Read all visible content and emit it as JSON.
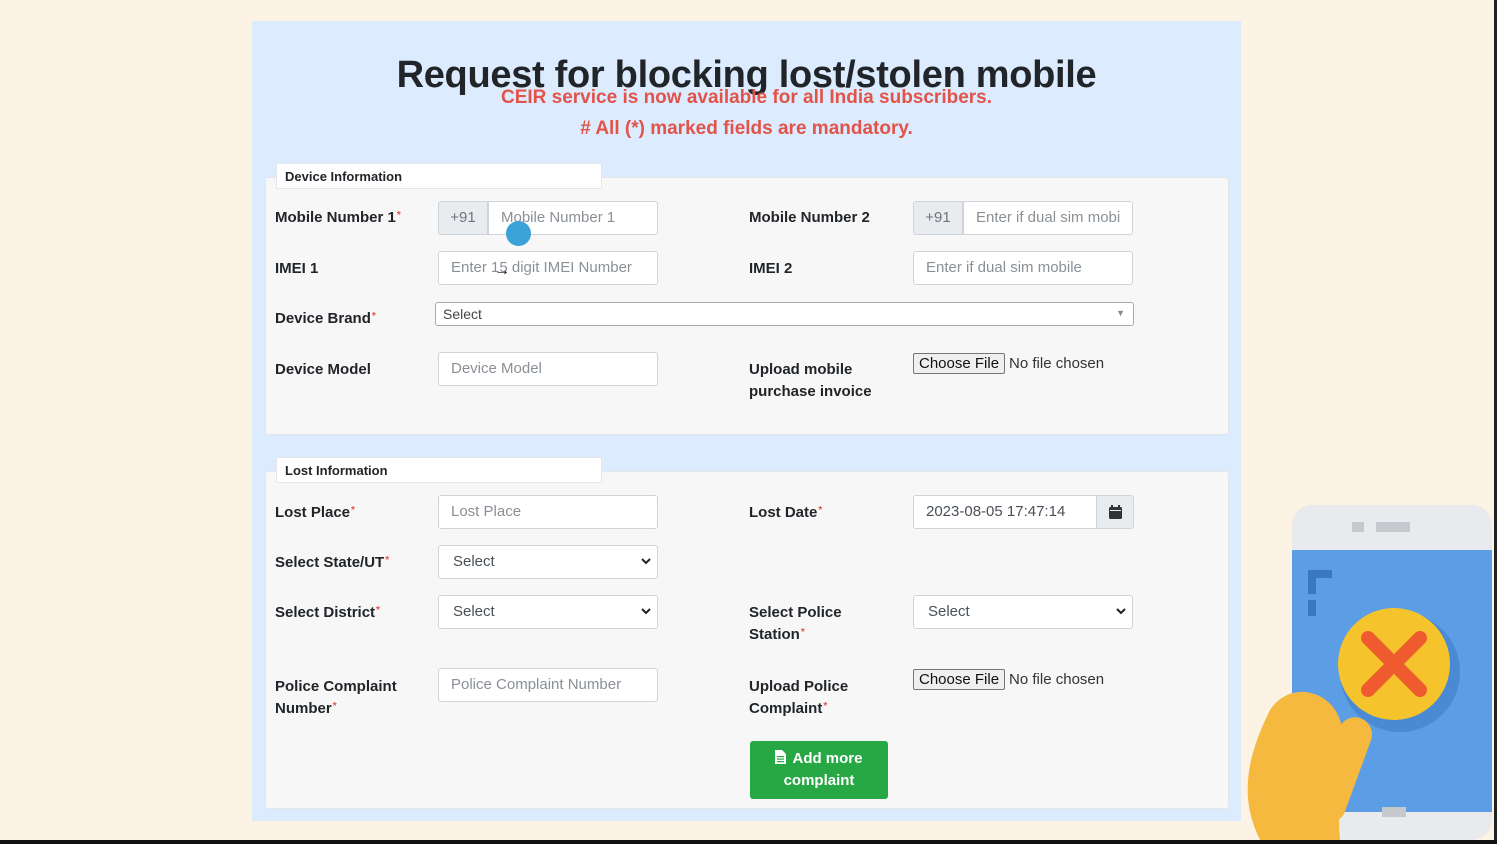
{
  "header": {
    "title": "Request for blocking lost/stolen mobile",
    "notice": "CEIR service is now available for all India subscribers.",
    "mandatory_note": "# All (*) marked fields are mandatory."
  },
  "device_section": {
    "legend": "Device Information",
    "mobile1": {
      "label": "Mobile Number 1",
      "prefix": "+91",
      "placeholder": "Mobile Number 1"
    },
    "mobile2": {
      "label": "Mobile Number 2",
      "prefix": "+91",
      "placeholder": "Enter if dual sim mobi"
    },
    "imei1": {
      "label": "IMEI 1",
      "placeholder": "Enter 15 digit IMEI Number"
    },
    "imei2": {
      "label": "IMEI 2",
      "placeholder": "Enter if dual sim mobile"
    },
    "brand": {
      "label": "Device Brand",
      "value": "Select"
    },
    "model": {
      "label": "Device Model",
      "placeholder": "Device Model"
    },
    "invoice": {
      "label_line1": "Upload mobile",
      "label_line2": "purchase invoice",
      "button": "Choose File",
      "status": "No file chosen"
    }
  },
  "lost_section": {
    "legend": "Lost Information",
    "place": {
      "label": "Lost Place",
      "placeholder": "Lost Place"
    },
    "date": {
      "label": "Lost Date",
      "value": "2023-08-05 17:47:14"
    },
    "state": {
      "label": "Select State/UT",
      "value": "Select"
    },
    "district": {
      "label": "Select District",
      "value": "Select"
    },
    "station": {
      "label_line1": "Select Police",
      "label_line2": "Station",
      "value": "Select"
    },
    "complaint_number": {
      "label_line1": "Police Complaint",
      "label_line2": "Number",
      "placeholder": "Police Complaint Number"
    },
    "complaint_upload": {
      "label_line1": "Upload Police",
      "label_line2": "Complaint",
      "button": "Choose File",
      "status": "No file chosen"
    },
    "add_button": {
      "line1": "Add more",
      "line2": "complaint"
    }
  },
  "required_mark": "*",
  "colors": {
    "accent_red": "#e2534a",
    "button_green": "#28a745",
    "panel_blue": "#dcebfd",
    "page_bg": "#fdf3e4"
  },
  "icons": [
    "calendar-icon",
    "file-icon",
    "chevron-down-icon",
    "blocked-phone-illustration"
  ]
}
